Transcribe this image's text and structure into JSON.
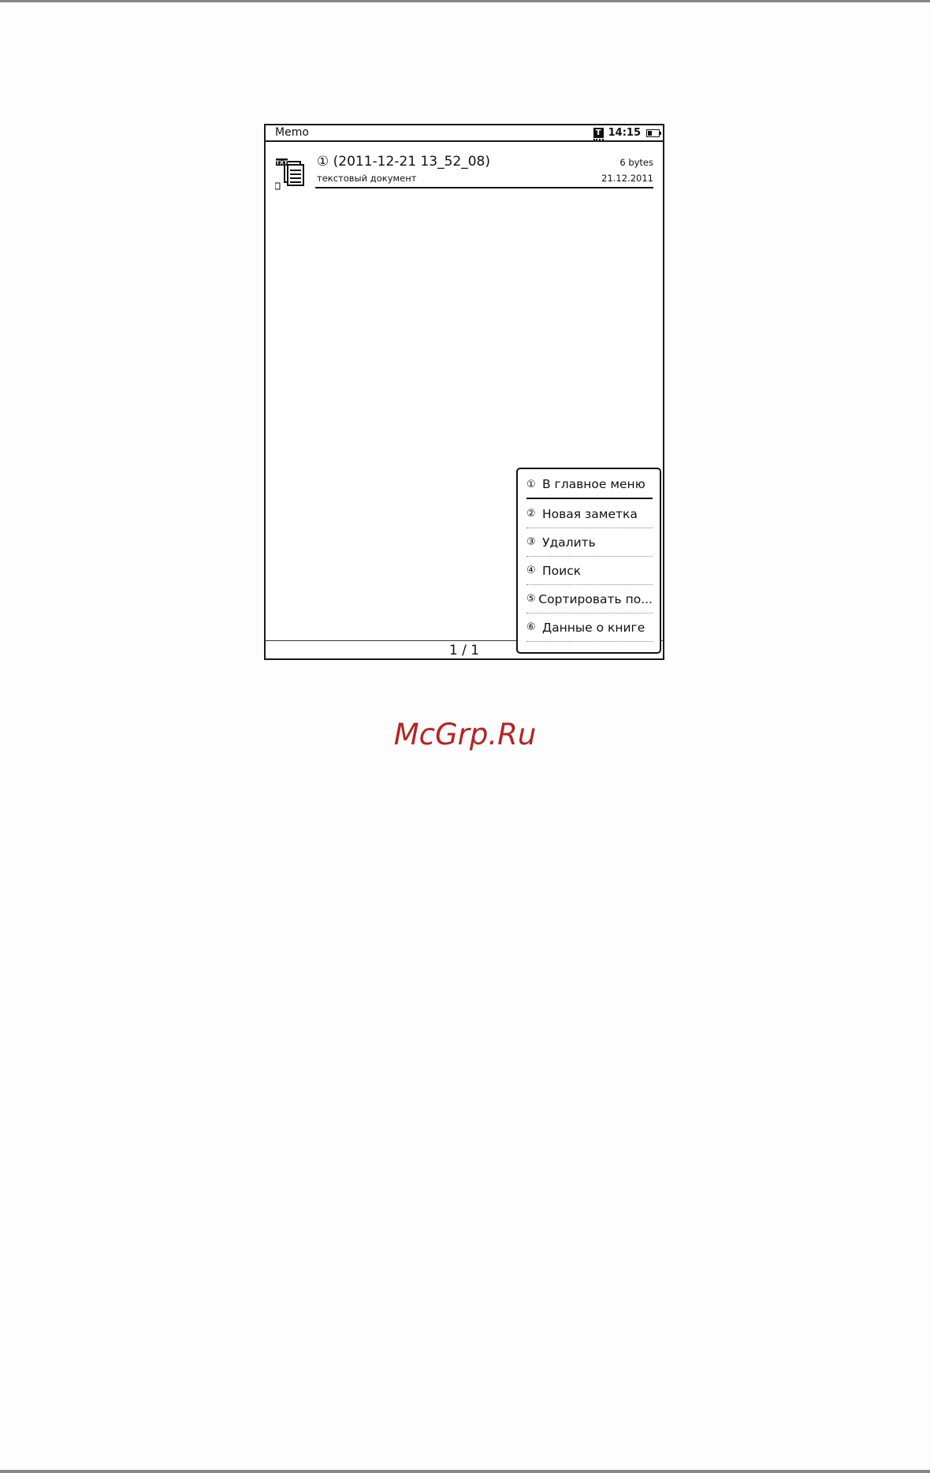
{
  "status_bar": {
    "app_title": "Memo",
    "text_mode_icon": "T",
    "time": "14:15",
    "battery_icon": "battery-icon"
  },
  "file_entry": {
    "icon": "txt-document-icon",
    "icon_label": "TXT",
    "name": "① (2011-12-21 13_52_08)",
    "size": "6 bytes",
    "type": "текстовый документ",
    "date": "21.12.2011"
  },
  "context_menu": {
    "items": [
      {
        "num": "①",
        "label": "В главное меню"
      },
      {
        "num": "②",
        "label": "Новая заметка"
      },
      {
        "num": "③",
        "label": "Удалить"
      },
      {
        "num": "④",
        "label": "Поиск"
      },
      {
        "num": "⑤",
        "label": "Сортировать по..."
      },
      {
        "num": "⑥",
        "label": "Данные о книге"
      }
    ]
  },
  "pagination": {
    "text": "1 / 1"
  },
  "watermark": {
    "text": "McGrp.Ru",
    "color": "#b52424"
  }
}
